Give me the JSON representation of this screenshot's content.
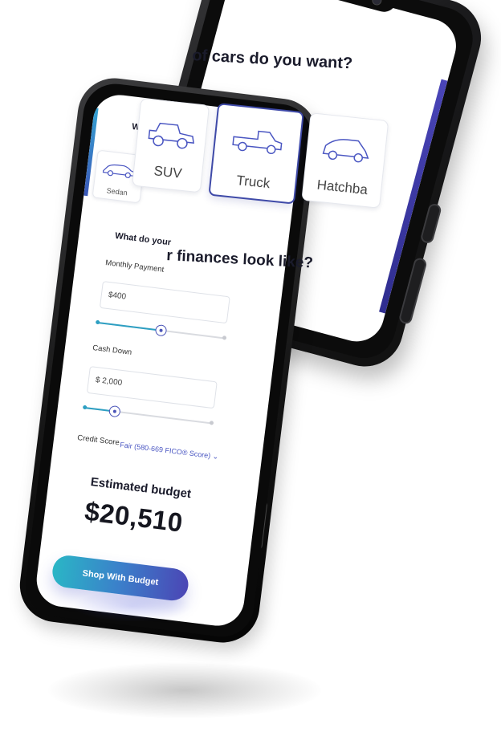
{
  "app": {
    "back_screen_heading": "of cars do you want?",
    "front_screen_heading": "What k",
    "finances_heading_small": "What do your",
    "finances_heading_big": "r finances look like?"
  },
  "car_types": [
    {
      "label": "Sedan",
      "icon": "sedan-icon"
    },
    {
      "label": "SUV",
      "icon": "suv-icon"
    },
    {
      "label": "Truck",
      "icon": "truck-icon",
      "selected": true
    },
    {
      "label": "Hatchba",
      "icon": "hatchback-icon"
    }
  ],
  "form": {
    "monthly_payment": {
      "label": "Monthly Payment",
      "value": "$400",
      "slider_fraction": 0.5
    },
    "cash_down": {
      "label": "Cash Down",
      "value": "$ 2,000",
      "slider_fraction": 0.24
    },
    "credit_score": {
      "label": "Credit Score",
      "value": "Fair (580-669 FICO® Score)"
    }
  },
  "result": {
    "estimated_label": "Estimated budget",
    "estimated_value": "$20,510"
  },
  "cta": {
    "label": "Shop With Budget"
  },
  "colors": {
    "accent_blue": "#3f4aa8",
    "teal": "#2d9fc2",
    "gradient_start": "#2ab6c6",
    "gradient_end": "#4b46b5"
  }
}
